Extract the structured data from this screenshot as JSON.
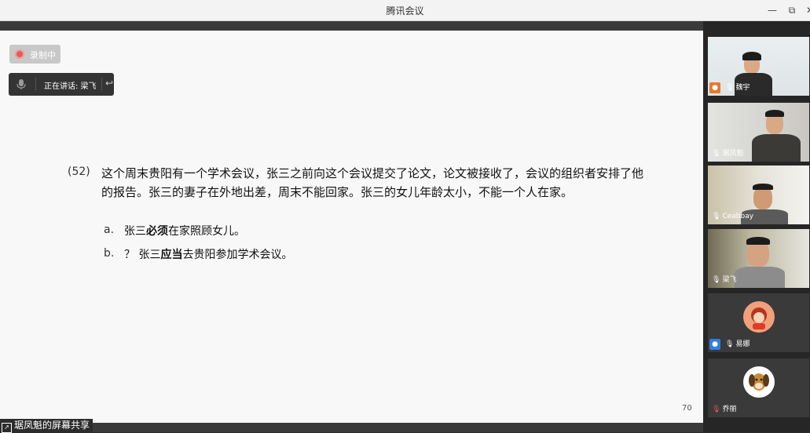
{
  "window": {
    "title": "腾讯会议",
    "controls": {
      "minimize": "—",
      "maximize": "⧉",
      "close": "✕"
    }
  },
  "recording": {
    "label": "录制中"
  },
  "speaking": {
    "label": "正在讲话: 梁飞"
  },
  "slide": {
    "example_number": "(52)",
    "paragraph": "这个周末贵阳有一个学术会议，张三之前向这个会议提交了论文，论文被接收了，会议的组织者安排了他的报告。张三的妻子在外地出差，周末不能回家。张三的女儿年龄太小，不能一个人在家。",
    "options": [
      {
        "letter": "a.",
        "prefix": "张三",
        "bold": "必须",
        "suffix": "在家照顾女儿。"
      },
      {
        "letter": "b.",
        "prefix": "？ 张三",
        "bold": "应当",
        "suffix": "去贵阳参加学术会议。"
      }
    ],
    "page_number": "70"
  },
  "share_tag": {
    "label": "琚凤魁的屏幕共享"
  },
  "participants": [
    {
      "name": "魏宇",
      "type": "video",
      "badge": "user"
    },
    {
      "name": "琚凤魁",
      "type": "video",
      "badge": "mic"
    },
    {
      "name": "Ceabbay",
      "type": "video",
      "badge": "mic"
    },
    {
      "name": "梁飞",
      "type": "video",
      "badge": "mic"
    },
    {
      "name": "易娜",
      "type": "avatar",
      "badge": "user"
    },
    {
      "name": "乔丽",
      "type": "avatar",
      "badge": "muted"
    }
  ],
  "colors": {
    "record_dot": "#e25a5a",
    "badge_orange": "#e8782a",
    "badge_blue": "#2f7fe0",
    "active_tile_border": "#3fae6a"
  }
}
